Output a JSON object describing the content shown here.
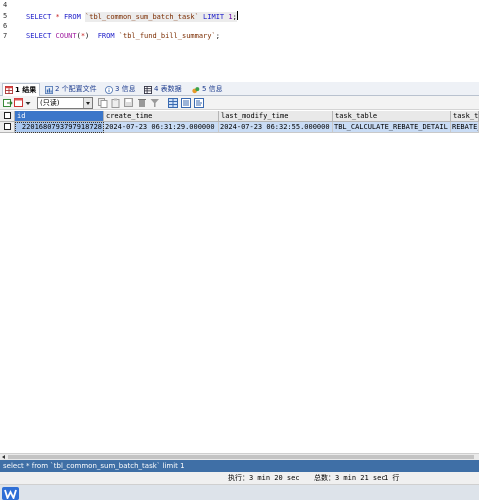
{
  "editor": {
    "line_numbers": [
      "4",
      "5",
      "6",
      "7"
    ],
    "line1": {
      "kw_select": "SELECT",
      "op_star": "*",
      "kw_from": "FROM",
      "table": "`tbl_common_sum_batch_task`",
      "kw_limit": "LIMIT",
      "limit_value": "1",
      "terminator": ";"
    },
    "line2": {
      "kw_select": "SELECT",
      "fn_count": "COUNT",
      "paren_open": "(",
      "op_star": "*",
      "paren_close": ")",
      "kw_from": "FROM",
      "table": "`tbl_fund_bill_summary`",
      "terminator": ";"
    }
  },
  "tabs": [
    {
      "label": "1 结果",
      "active": true,
      "icon": "table-grid-icon"
    },
    {
      "label": "2 个配置文件",
      "active": false,
      "icon": "profile-icon"
    },
    {
      "label": "3 信息",
      "active": false,
      "icon": "info-icon"
    },
    {
      "label": "4 表数据",
      "active": false,
      "icon": "table-data-icon"
    },
    {
      "label": "5 信息",
      "active": false,
      "icon": "messages-icon"
    }
  ],
  "toolbar": {
    "mode_select_value": "(只读)",
    "icons": [
      "export-icon",
      "dropdown-icon",
      "copy-icon",
      "paste-icon",
      "save-icon",
      "delete-icon",
      "filter-icon",
      "grid-view-icon",
      "form-view-icon",
      "text-view-icon"
    ]
  },
  "grid": {
    "columns": [
      "id",
      "create_time",
      "last_modify_time",
      "task_table",
      "task_ty"
    ],
    "rows": [
      [
        "2201680793797918728",
        "2024-07-23 06:31:29.000000",
        "2024-07-23 06:32:55.000000",
        "TBL_CALCULATE_REBATE_DETAIL",
        "REBATE_"
      ]
    ]
  },
  "status": {
    "query_text": "select * from `tbl_common_sum_batch_task` limit 1"
  },
  "info": {
    "exec_label": "执行：3 min 20 sec",
    "total_label": "总数：3 min 21 sec",
    "rows_label": "1 行"
  },
  "taskbar": {
    "app_icon": "wps-icon"
  },
  "colors": {
    "keyword": "#1c1cc9",
    "function": "#a01ea0",
    "string": "#7b2c00",
    "status_bar": "#3f6fa6",
    "selected_row": "#c9dcf5"
  }
}
